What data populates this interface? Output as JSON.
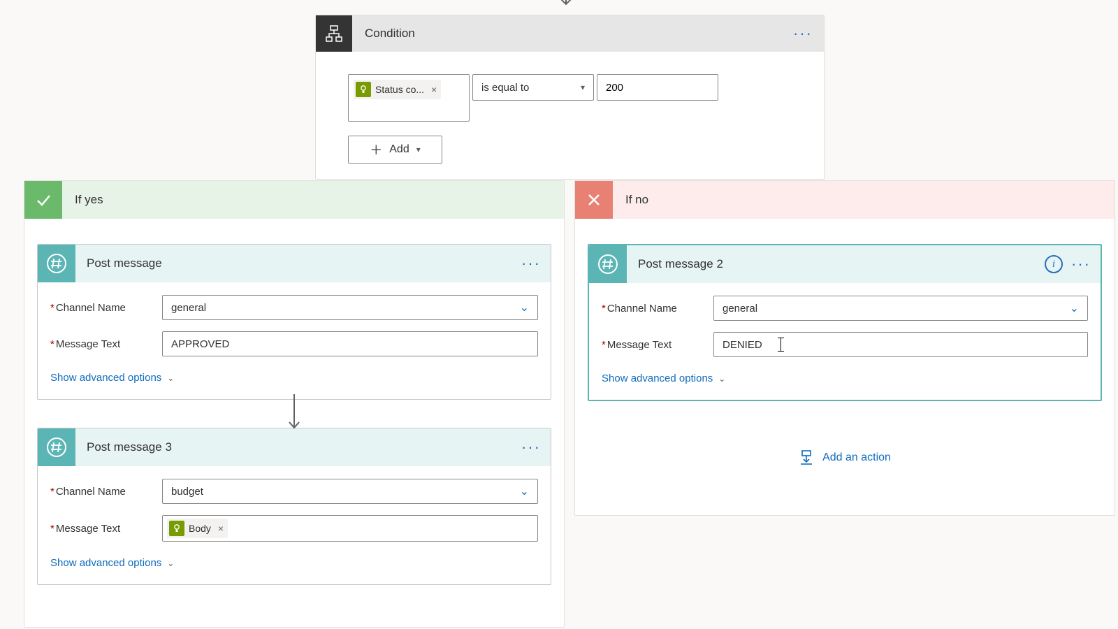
{
  "condition": {
    "title": "Condition",
    "token_label": "Status co...",
    "operator": "is equal to",
    "value": "200",
    "add_label": "Add"
  },
  "branches": {
    "yes": {
      "title": "If yes"
    },
    "no": {
      "title": "If no"
    }
  },
  "actions": {
    "post1": {
      "title": "Post message",
      "channel_label": "Channel Name",
      "channel_value": "general",
      "message_label": "Message Text",
      "message_value": "APPROVED",
      "advanced": "Show advanced options"
    },
    "post3": {
      "title": "Post message 3",
      "channel_label": "Channel Name",
      "channel_value": "budget",
      "message_label": "Message Text",
      "token_label": "Body",
      "advanced": "Show advanced options"
    },
    "post2": {
      "title": "Post message 2",
      "channel_label": "Channel Name",
      "channel_value": "general",
      "message_label": "Message Text",
      "message_value": "DENIED",
      "advanced": "Show advanced options"
    }
  },
  "add_action": "Add an action"
}
